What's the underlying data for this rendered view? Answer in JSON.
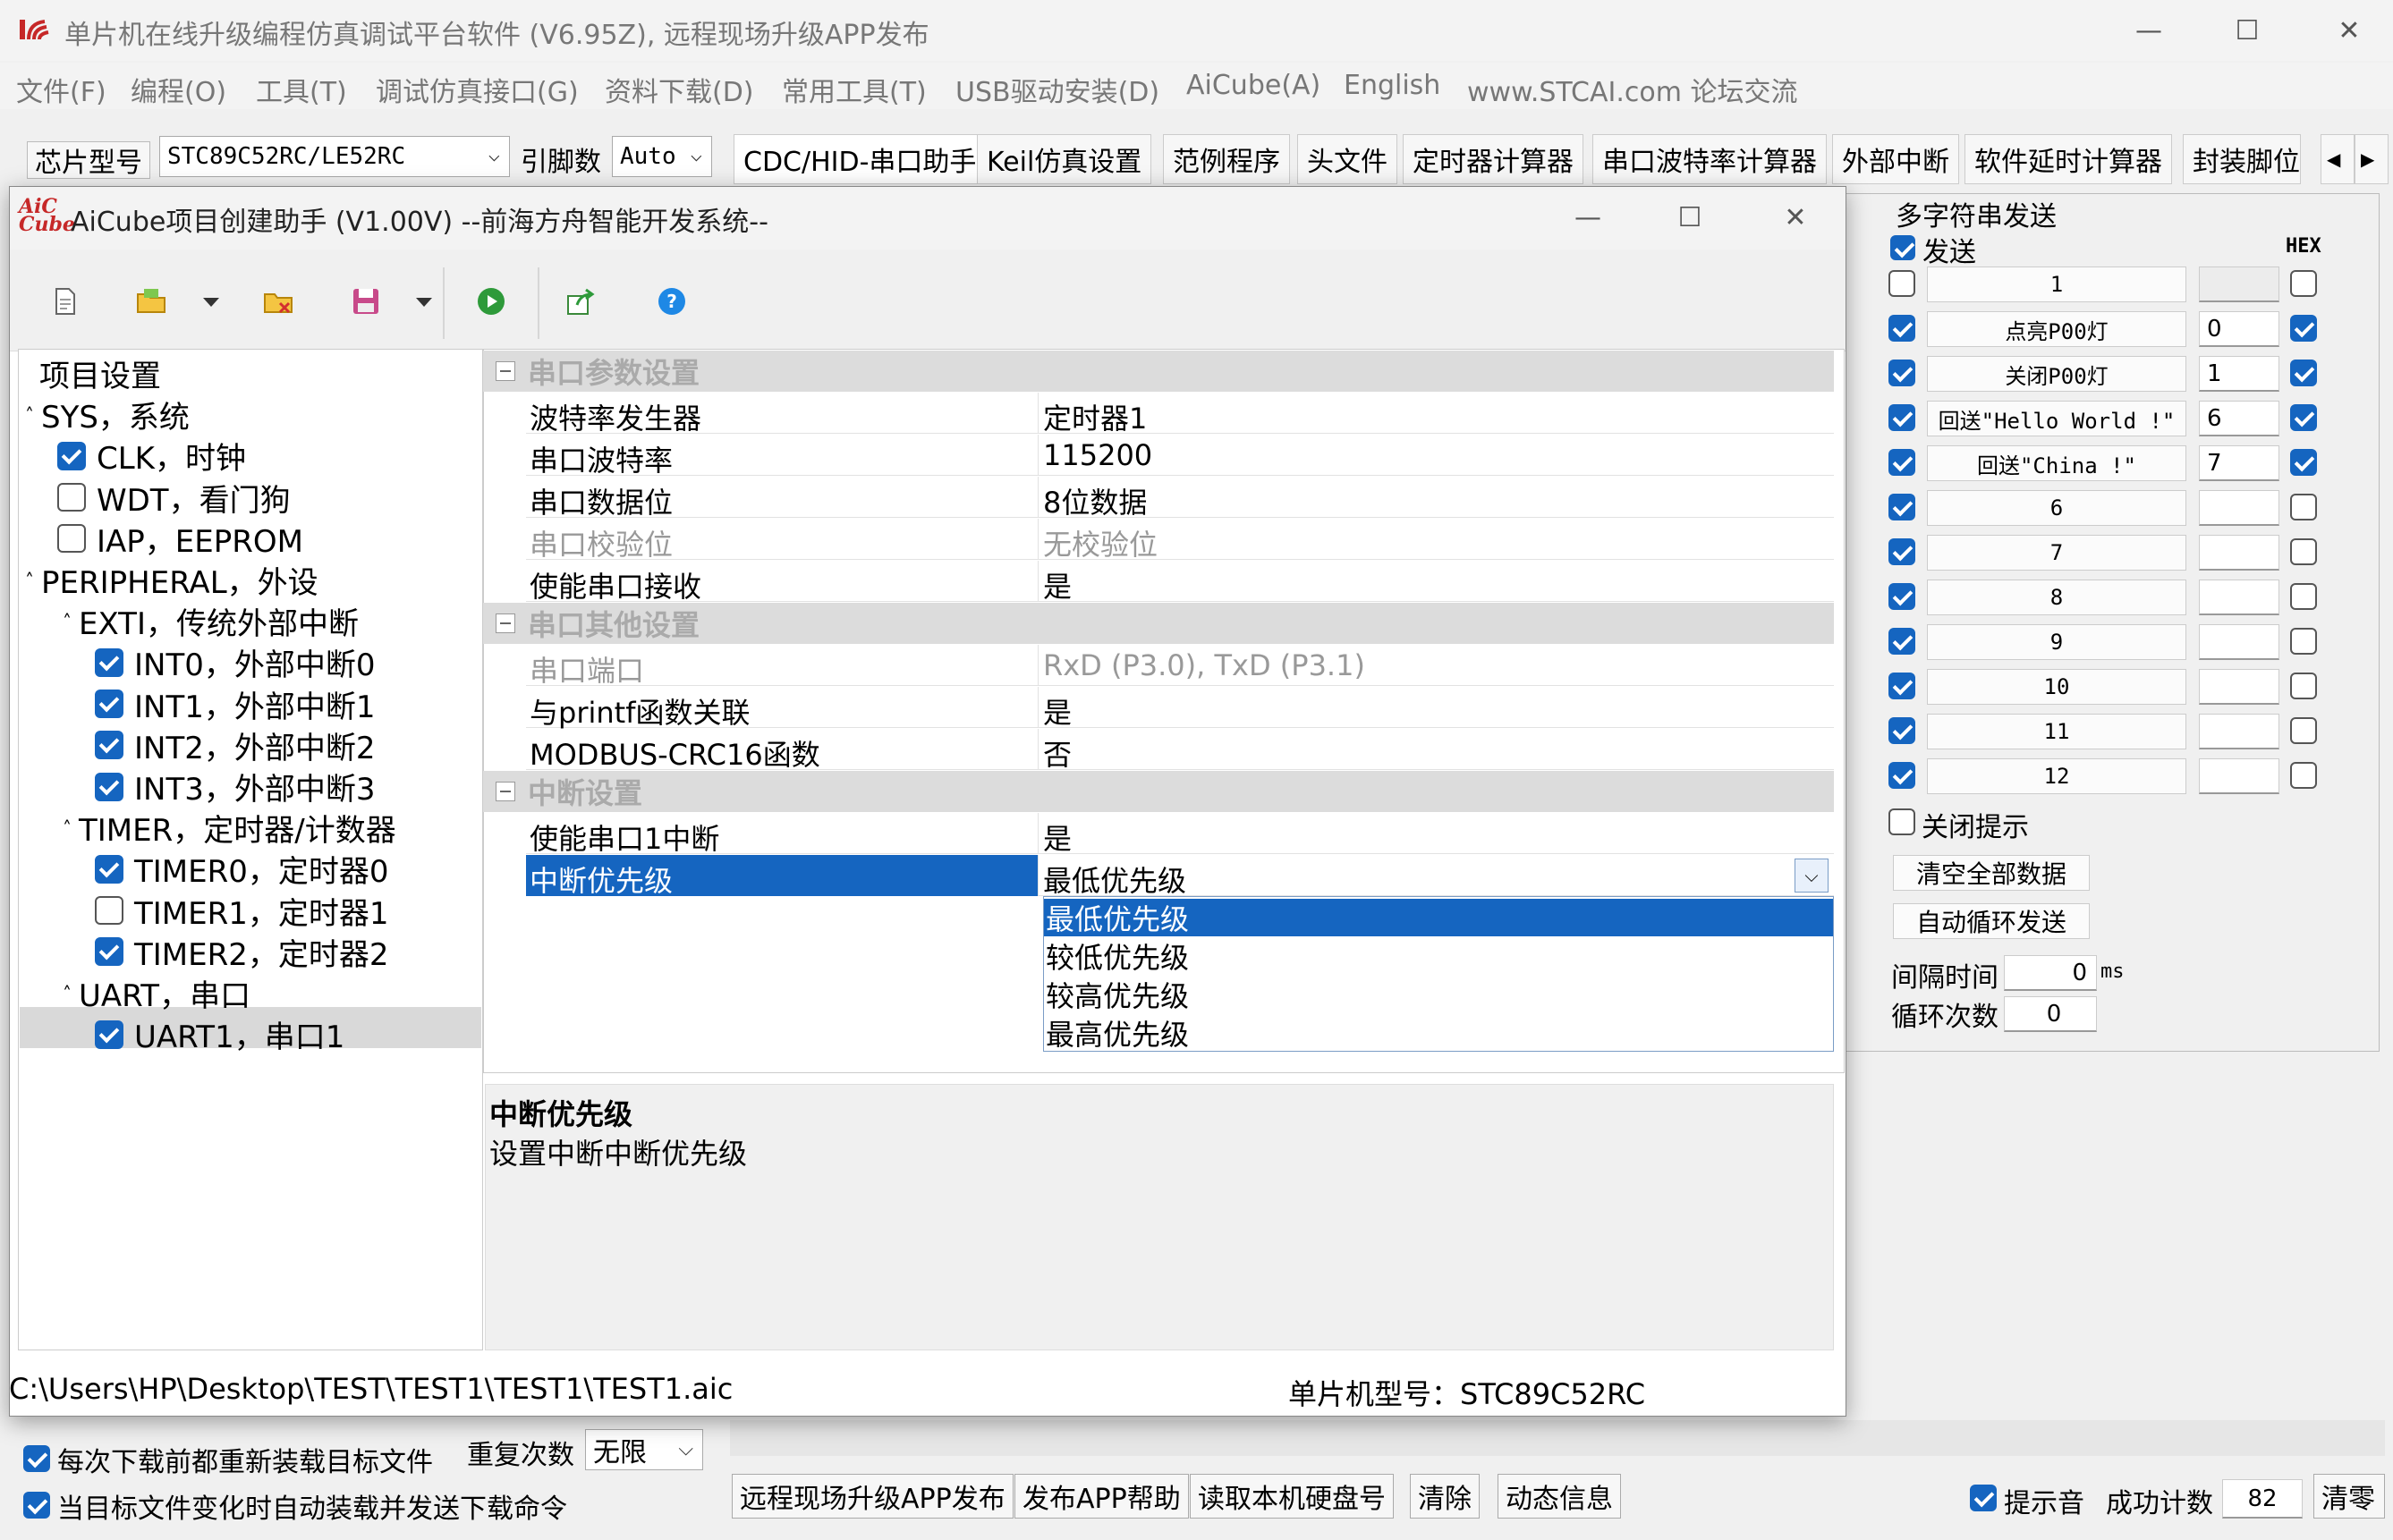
{
  "main_window": {
    "title": "单片机在线升级编程仿真调试平台软件 (V6.95Z), 远程现场升级APP发布",
    "controls": {
      "minimize": "—",
      "maximize": "☐",
      "close": "✕"
    }
  },
  "menu": [
    "文件(F)",
    "编程(O)",
    "工具(T)",
    "调试仿真接口(G)",
    "资料下载(D)",
    "常用工具(T)",
    "USB驱动安装(D)",
    "AiCube(A)",
    "English",
    "www.STCAI.com 论坛交流"
  ],
  "toolbar": {
    "chip_label": "芯片型号",
    "chip_value": "STC89C52RC/LE52RC",
    "pins_label": "引脚数",
    "pins_value": "Auto"
  },
  "tabs": [
    "CDC/HID-串口助手",
    "Keil仿真设置",
    "范例程序",
    "头文件",
    "定时器计算器",
    "串口波特率计算器",
    "外部中断",
    "软件延时计算器",
    "封装脚位"
  ],
  "tab_scroll": {
    "left": "◀",
    "right": "▶"
  },
  "right_panel": {
    "group_title": "多字符串发送",
    "send_header": "发送",
    "hex_header": "HEX",
    "rows": [
      {
        "checked": false,
        "label": "1",
        "value": "",
        "hex": false
      },
      {
        "checked": true,
        "label": "点亮P00灯",
        "value": "0",
        "hex": true
      },
      {
        "checked": true,
        "label": "关闭P00灯",
        "value": "1",
        "hex": true
      },
      {
        "checked": true,
        "label": "回送\"Hello World !\"",
        "value": "6",
        "hex": true
      },
      {
        "checked": true,
        "label": "回送\"China !\"",
        "value": "7",
        "hex": true
      },
      {
        "checked": true,
        "label": "6",
        "value": "",
        "hex": false
      },
      {
        "checked": true,
        "label": "7",
        "value": "",
        "hex": false
      },
      {
        "checked": true,
        "label": "8",
        "value": "",
        "hex": false
      },
      {
        "checked": true,
        "label": "9",
        "value": "",
        "hex": false
      },
      {
        "checked": true,
        "label": "10",
        "value": "",
        "hex": false
      },
      {
        "checked": true,
        "label": "11",
        "value": "",
        "hex": false
      },
      {
        "checked": true,
        "label": "12",
        "value": "",
        "hex": false
      }
    ],
    "close_tip": "关闭提示",
    "clear_all": "清空全部数据",
    "auto_loop": "自动循环发送",
    "interval_label": "间隔时间",
    "interval_value": "0",
    "interval_unit": "ms",
    "loop_label": "循环次数",
    "loop_value": "0"
  },
  "bottom": {
    "reload_label": "每次下载前都重新装载目标文件",
    "auto_label": "当目标文件变化时自动装载并发送下载命令",
    "repeat_label": "重复次数",
    "repeat_value": "无限",
    "buttons": [
      "远程现场升级APP发布",
      "发布APP帮助",
      "读取本机硬盘号",
      "清除",
      "动态信息"
    ],
    "sound_label": "提示音",
    "success_label": "成功计数",
    "success_value": "82",
    "clear_count": "清零"
  },
  "dialog": {
    "logo_text": "AiC Cube",
    "title": "AiCube项目创建助手 (V1.00V) --前海方舟智能开发系统--",
    "tree": [
      {
        "label": "项目设置",
        "checkbox": null
      },
      {
        "label": "SYS，系统",
        "checkbox": null,
        "expander": "˄"
      },
      {
        "label": "CLK，时钟",
        "checkbox": true
      },
      {
        "label": "WDT，看门狗",
        "checkbox": false
      },
      {
        "label": "IAP，EEPROM",
        "checkbox": false
      },
      {
        "label": "PERIPHERAL，外设",
        "checkbox": null,
        "expander": "˄"
      },
      {
        "label": "EXTI，传统外部中断",
        "checkbox": null,
        "expander": "˄"
      },
      {
        "label": "INT0，外部中断0",
        "checkbox": true
      },
      {
        "label": "INT1，外部中断1",
        "checkbox": true
      },
      {
        "label": "INT2，外部中断2",
        "checkbox": true
      },
      {
        "label": "INT3，外部中断3",
        "checkbox": true
      },
      {
        "label": "TIMER，定时器/计数器",
        "checkbox": null,
        "expander": "˄"
      },
      {
        "label": "TIMER0，定时器0",
        "checkbox": true
      },
      {
        "label": "TIMER1，定时器1",
        "checkbox": false
      },
      {
        "label": "TIMER2，定时器2",
        "checkbox": true
      },
      {
        "label": "UART，串口",
        "checkbox": null,
        "expander": "˄"
      },
      {
        "label": "UART1，串口1",
        "checkbox": true
      }
    ],
    "groups": [
      {
        "title": "串口参数设置",
        "props": [
          {
            "name": "波特率发生器",
            "value": "定时器1",
            "disabled": false
          },
          {
            "name": "串口波特率",
            "value": "115200",
            "disabled": false
          },
          {
            "name": "串口数据位",
            "value": "8位数据",
            "disabled": false
          },
          {
            "name": "串口校验位",
            "value": "无校验位",
            "disabled": true
          },
          {
            "name": "使能串口接收",
            "value": "是",
            "disabled": false
          }
        ]
      },
      {
        "title": "串口其他设置",
        "props": [
          {
            "name": "串口端口",
            "value": "RxD (P3.0), TxD (P3.1)",
            "disabled": true
          },
          {
            "name": "与printf函数关联",
            "value": "是",
            "disabled": false
          },
          {
            "name": "MODBUS-CRC16函数",
            "value": "否",
            "disabled": false
          }
        ]
      },
      {
        "title": "中断设置",
        "props": [
          {
            "name": "使能串口1中断",
            "value": "是",
            "disabled": false
          },
          {
            "name": "中断优先级",
            "value": "最低优先级",
            "disabled": false
          }
        ]
      }
    ],
    "dropdown_options": [
      "最低优先级",
      "较低优先级",
      "较高优先级",
      "最高优先级"
    ],
    "desc_title": "中断优先级",
    "desc_text": "设置中断中断优先级",
    "status_path": "C:\\Users\\HP\\Desktop\\TEST\\TEST1\\TEST1\\TEST1.aic",
    "status_mcu": "单片机型号：STC89C52RC"
  },
  "colors": {
    "select": "#1565c0",
    "check": "#1565c0"
  }
}
